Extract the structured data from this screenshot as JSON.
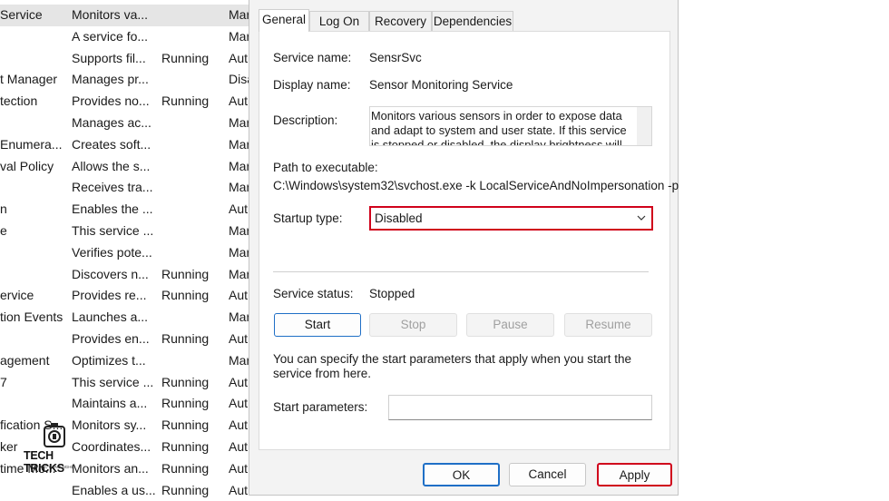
{
  "services_list": {
    "rows": [
      {
        "name": "Service",
        "description": "Monitors va...",
        "status": "",
        "startup": "Mar"
      },
      {
        "name": "",
        "description": "A service fo...",
        "status": "",
        "startup": "Mar"
      },
      {
        "name": "",
        "description": "Supports fil...",
        "status": "Running",
        "startup": "Aut"
      },
      {
        "name": "t Manager",
        "description": "Manages pr...",
        "status": "",
        "startup": "Disa"
      },
      {
        "name": "tection",
        "description": "Provides no...",
        "status": "Running",
        "startup": "Aut"
      },
      {
        "name": "",
        "description": "Manages ac...",
        "status": "",
        "startup": "Mar"
      },
      {
        "name": " Enumera...",
        "description": "Creates soft...",
        "status": "",
        "startup": "Mar"
      },
      {
        "name": "val Policy",
        "description": "Allows the s...",
        "status": "",
        "startup": "Mar"
      },
      {
        "name": "",
        "description": "Receives tra...",
        "status": "",
        "startup": "Mar"
      },
      {
        "name": "n",
        "description": "Enables the ...",
        "status": "",
        "startup": "Aut"
      },
      {
        "name": "e",
        "description": "This service ...",
        "status": "",
        "startup": "Mar"
      },
      {
        "name": "",
        "description": "Verifies pote...",
        "status": "",
        "startup": "Mar"
      },
      {
        "name": "",
        "description": "Discovers n...",
        "status": "Running",
        "startup": "Mar"
      },
      {
        "name": "ervice",
        "description": "Provides re...",
        "status": "Running",
        "startup": "Aut"
      },
      {
        "name": "tion Events",
        "description": "Launches a...",
        "status": "",
        "startup": "Mar"
      },
      {
        "name": "",
        "description": "Provides en...",
        "status": "Running",
        "startup": "Aut"
      },
      {
        "name": "agement",
        "description": "Optimizes t...",
        "status": "",
        "startup": "Mar"
      },
      {
        "name": "7",
        "description": "This service ...",
        "status": "Running",
        "startup": "Aut"
      },
      {
        "name": "",
        "description": "Maintains a...",
        "status": "Running",
        "startup": "Aut"
      },
      {
        "name": "fication S...",
        "description": "Monitors sy...",
        "status": "Running",
        "startup": "Aut"
      },
      {
        "name": "ker",
        "description": "Coordinates...",
        "status": "Running",
        "startup": "Aut"
      },
      {
        "name": "time Mo...",
        "description": "Monitors an...",
        "status": "Running",
        "startup": "Aut"
      },
      {
        "name": "",
        "description": "Enables a us...",
        "status": "Running",
        "startup": "Aut"
      }
    ]
  },
  "watermark": {
    "main": "TECH TRICKS",
    "sub": "TIN HỌC CÔNG NGHỆ"
  },
  "dialog": {
    "tabs": [
      "General",
      "Log On",
      "Recovery",
      "Dependencies"
    ],
    "service_name_label": "Service name:",
    "service_name": "SensrSvc",
    "display_name_label": "Display name:",
    "display_name": "Sensor Monitoring Service",
    "description_label": "Description:",
    "description": "Monitors various sensors in order to expose data and adapt to system and user state.  If this service is stopped or disabled, the display brightness will not",
    "path_label": "Path to executable:",
    "path": "C:\\Windows\\system32\\svchost.exe -k LocalServiceAndNoImpersonation -p",
    "startup_type_label": "Startup type:",
    "startup_type": "Disabled",
    "service_status_label": "Service status:",
    "service_status": "Stopped",
    "buttons": {
      "start": "Start",
      "stop": "Stop",
      "pause": "Pause",
      "resume": "Resume"
    },
    "hint": "You can specify the start parameters that apply when you start the service from here.",
    "start_params_label": "Start parameters:",
    "start_params_value": "",
    "ok": "OK",
    "cancel": "Cancel",
    "apply": "Apply"
  },
  "colors": {
    "highlight_red": "#d0021b",
    "focus_blue": "#1f6fc6",
    "dialog_bg": "#f3f3f3"
  },
  "icons": {
    "dropdown": "chevron-down-icon",
    "watermark": "tech-tricks-logo"
  }
}
